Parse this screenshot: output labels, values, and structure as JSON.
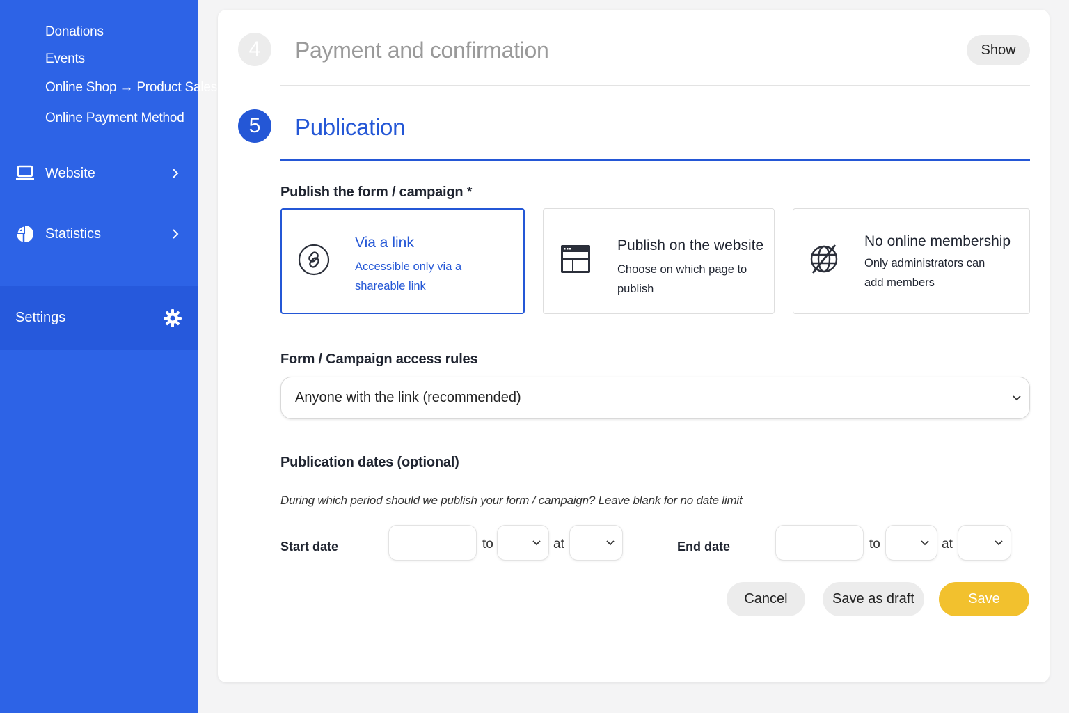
{
  "sidebar": {
    "sub_items": [
      "Donations",
      "Events",
      "Online Shop → Product Sales",
      "Online Payment Method"
    ],
    "nav": [
      {
        "label": "Website",
        "icon": "laptop-icon"
      },
      {
        "label": "Statistics",
        "icon": "pie-chart-icon"
      }
    ],
    "settings": {
      "label": "Settings",
      "icon": "gear-icon"
    }
  },
  "steps": {
    "step4": {
      "number": "4",
      "title": "Payment and confirmation",
      "show_label": "Show"
    },
    "step5": {
      "number": "5",
      "title": "Publication"
    }
  },
  "publication": {
    "publish_label": "Publish the form / campaign *",
    "options": [
      {
        "title": "Via a link",
        "description": "Accessible only via a shareable link",
        "icon": "link-icon",
        "selected": true
      },
      {
        "title": "Publish on the website",
        "description": "Choose on which page to publish",
        "icon": "browser-window-icon",
        "selected": false
      },
      {
        "title": "No online membership",
        "description": "Only administrators can add members",
        "icon": "globe-off-icon",
        "selected": false
      }
    ],
    "access_label": "Form / Campaign access rules",
    "access_value": "Anyone with the link (recommended)",
    "dates_label": "Publication dates (optional)",
    "dates_help": "During which period should we publish your form / campaign? Leave blank for no date limit",
    "start_label": "Start date",
    "end_label": "End date",
    "to_label": "to",
    "at_label": "at"
  },
  "actions": {
    "cancel": "Cancel",
    "save_draft": "Save as draft",
    "save": "Save"
  },
  "colors": {
    "sidebar": "#2d63e6",
    "primary": "#2457d6",
    "save": "#f2c12e"
  }
}
